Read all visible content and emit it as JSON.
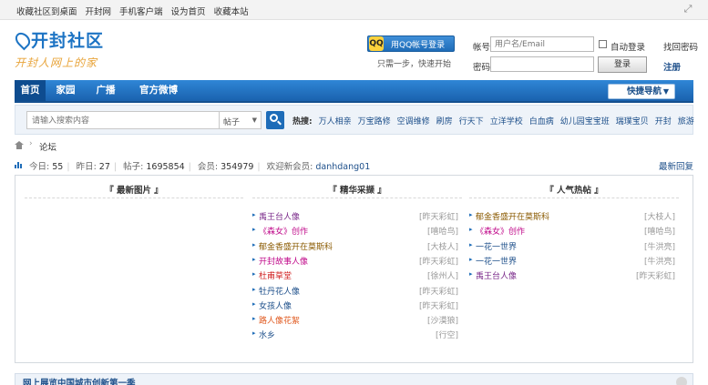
{
  "topbar": {
    "links": [
      "收藏社区到桌面",
      "开封网",
      "手机客户端",
      "设为首页",
      "收藏本站"
    ]
  },
  "logo": {
    "title": "开封社区",
    "slogan": "开封人网上的家"
  },
  "login": {
    "qq_button": "用QQ帐号登录",
    "qq_icon": "QQ",
    "quick_text": "只需一步，快速开始",
    "account_label": "帐号",
    "account_placeholder": "用户名/Email",
    "auto_login": "自动登录",
    "forgot": "找回密码",
    "password_label": "密码",
    "login_button": "登录",
    "register": "注册"
  },
  "nav": {
    "items": [
      "首页",
      "家园",
      "广播",
      "官方微博"
    ],
    "quick_nav": "快捷导航"
  },
  "search": {
    "placeholder": "请输入搜索内容",
    "scope": "帖子",
    "hot_label": "热搜:",
    "hot_terms": [
      "万人相亲",
      "万宝路修",
      "空调维修",
      "刷房",
      "行天下",
      "立洋学校",
      "白血病",
      "幼儿园宝宝班",
      "瑞璞宝贝",
      "开封",
      "旅游"
    ]
  },
  "breadcrumb": {
    "current": "论坛"
  },
  "stats": {
    "today_label": "今日:",
    "today": "55",
    "yesterday_label": "昨日:",
    "yesterday": "27",
    "posts_label": "帖子:",
    "posts": "1695854",
    "members_label": "会员:",
    "members": "354979",
    "newest_label": "欢迎新会员:",
    "newest": "danhdang01",
    "latest_reply": "最新回复"
  },
  "columns": {
    "latest_images": "『 最新图片 』",
    "featured": "『 精华采撷 』",
    "popular": "『 人气热帖 』"
  },
  "featured_posts": [
    {
      "title": "禹王台人像",
      "author": "[昨天彩虹]",
      "color": "#7a2a8a"
    },
    {
      "title": "《森女》创作",
      "author": "[嘻哈鸟]",
      "color": "#c00a8a"
    },
    {
      "title": "郁金香盛开在莫斯科",
      "author": "[大枝人]",
      "color": "#8a5a00"
    },
    {
      "title": "开封故事人像",
      "author": "[昨天彩虹]",
      "color": "#c00a8a"
    },
    {
      "title": "杜甫草堂",
      "author": "[徐州人]",
      "color": "#d02020"
    },
    {
      "title": "牡丹花人像",
      "author": "[昨天彩虹]",
      "color": "#1d4f8a"
    },
    {
      "title": "女孩人像",
      "author": "[昨天彩虹]",
      "color": "#1d4f8a"
    },
    {
      "title": "路人像花絮",
      "author": "[沙漠狼]",
      "color": "#e05a20"
    },
    {
      "title": "水乡",
      "author": "[行空]",
      "color": "#1d4f8a"
    }
  ],
  "popular_posts": [
    {
      "title": "郁金香盛开在莫斯科",
      "author": "[大枝人]",
      "color": "#8a5a00"
    },
    {
      "title": "《森女》创作",
      "author": "[嘻哈鸟]",
      "color": "#c00a8a"
    },
    {
      "title": "一花一世界",
      "author": "[牛洪亮]",
      "color": "#1d4f8a"
    },
    {
      "title": "一花一世界",
      "author": "[牛洪亮]",
      "color": "#1d4f8a"
    },
    {
      "title": "禹王台人像",
      "author": "[昨天彩虹]",
      "color": "#7a2a8a"
    }
  ],
  "bottom_bar": "网上展览中国城市创新第一季"
}
